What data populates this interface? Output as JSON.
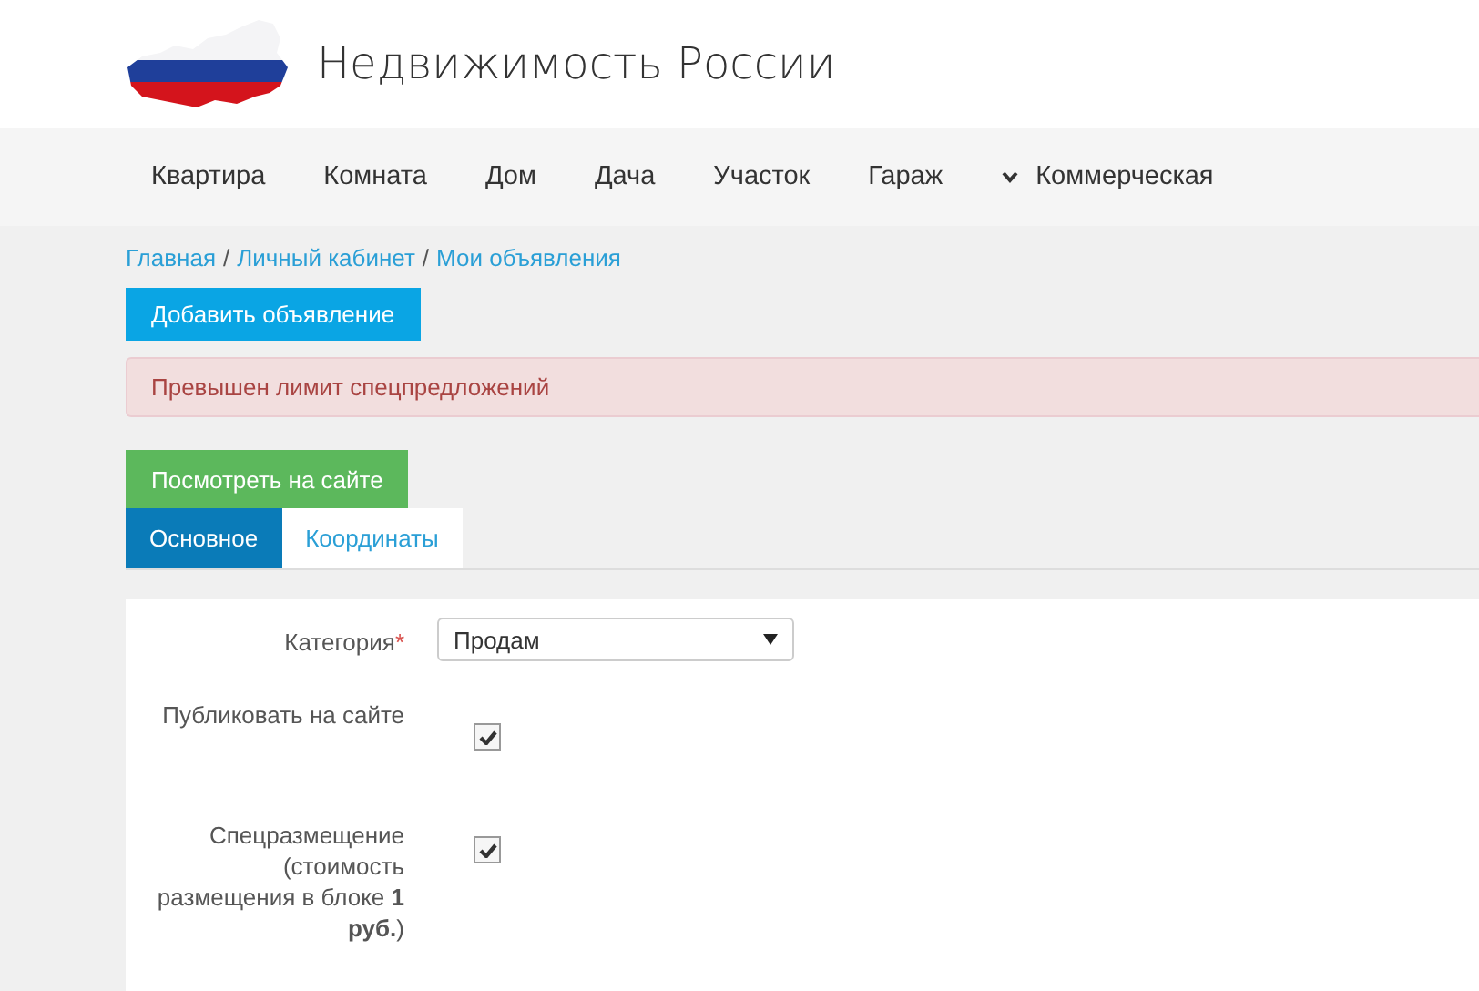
{
  "site": {
    "title": "Недвижимость России"
  },
  "nav": [
    {
      "label": "Квартира",
      "has_dropdown": false
    },
    {
      "label": "Комната",
      "has_dropdown": false
    },
    {
      "label": "Дом",
      "has_dropdown": false
    },
    {
      "label": "Дача",
      "has_dropdown": false
    },
    {
      "label": "Участок",
      "has_dropdown": false
    },
    {
      "label": "Гараж",
      "has_dropdown": false
    },
    {
      "label": "Коммерческая",
      "has_dropdown": true
    }
  ],
  "breadcrumb": {
    "separator": "/",
    "items": [
      "Главная",
      "Личный кабинет",
      "Мои объявления"
    ]
  },
  "add_button": "Добавить объявление",
  "alert": "Превышен лимит спецпредложений",
  "view_button": "Посмотреть на сайте",
  "tabs": [
    {
      "label": "Основное",
      "selected": true
    },
    {
      "label": "Координаты",
      "selected": false
    }
  ],
  "form": [
    {
      "kind": "select",
      "label": "Категория",
      "required_mark": "*",
      "value": "Продам"
    },
    {
      "kind": "checkbox",
      "label": "Публиковать на сайте",
      "checked": true
    },
    {
      "kind": "checkbox",
      "label": "Спецразмещение (стоимость размещения в блоке **1 руб.**)",
      "checked": true
    }
  ]
}
